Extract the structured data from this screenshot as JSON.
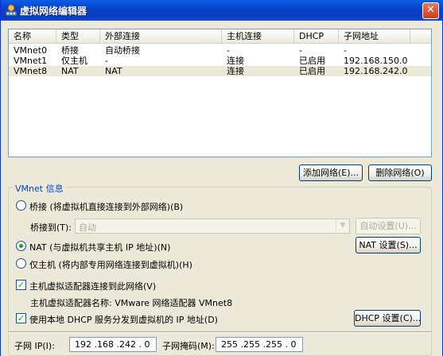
{
  "window": {
    "title": "虚拟网络编辑器",
    "close_glyph": "✕"
  },
  "list": {
    "columns": [
      "名称",
      "类型",
      "外部连接",
      "主机连接",
      "DHCP",
      "子网地址"
    ],
    "rows": [
      [
        "VMnet0",
        "桥接",
        "自动桥接",
        "-",
        "-",
        "-"
      ],
      [
        "VMnet1",
        "仅主机",
        "-",
        "连接",
        "已启用",
        "192.168.150.0"
      ],
      [
        "VMnet8",
        "NAT",
        "NAT",
        "连接",
        "已启用",
        "192.168.242.0"
      ]
    ],
    "selected_row": 2
  },
  "buttons": {
    "add_network": "添加网络(E)...",
    "remove_network": "删除网络(O)",
    "auto_settings": "自动设置(U)...",
    "nat_settings": "NAT 设置(S)...",
    "dhcp_settings": "DHCP 设置(C)..."
  },
  "vmnet_info": {
    "group_label": "VMnet 信息",
    "bridged_option": "桥接 (将虚拟机直接连接到外部网络)(B)",
    "bridged_to_label": "桥接到(T):",
    "bridged_to_value": "自动",
    "nat_option": "NAT (与虚拟机共享主机 IP 地址)(N)",
    "host_only_option": "仅主机 (将内部专用网络连接到虚拟机)(H)",
    "selected_mode": "nat",
    "connect_adapter_label": "主机虚拟适配器连接到此网络(V)",
    "connect_adapter_checked": true,
    "adapter_name_text": "主机虚拟适配器名称: VMware 网络适配器 VMnet8",
    "use_dhcp_label": "使用本地 DHCP 服务分发到虚拟机的 IP 地址(D)",
    "use_dhcp_checked": true,
    "subnet_ip_label": "子网 IP(I):",
    "subnet_ip_value": "192 .168 .242 . 0",
    "subnet_mask_label": "子网掩码(M):",
    "subnet_mask_value": "255 .255 .255 . 0"
  },
  "colors": {
    "title_bar": "#0842C8",
    "group_label": "#0046D5",
    "radio_dot": "#21A121"
  }
}
